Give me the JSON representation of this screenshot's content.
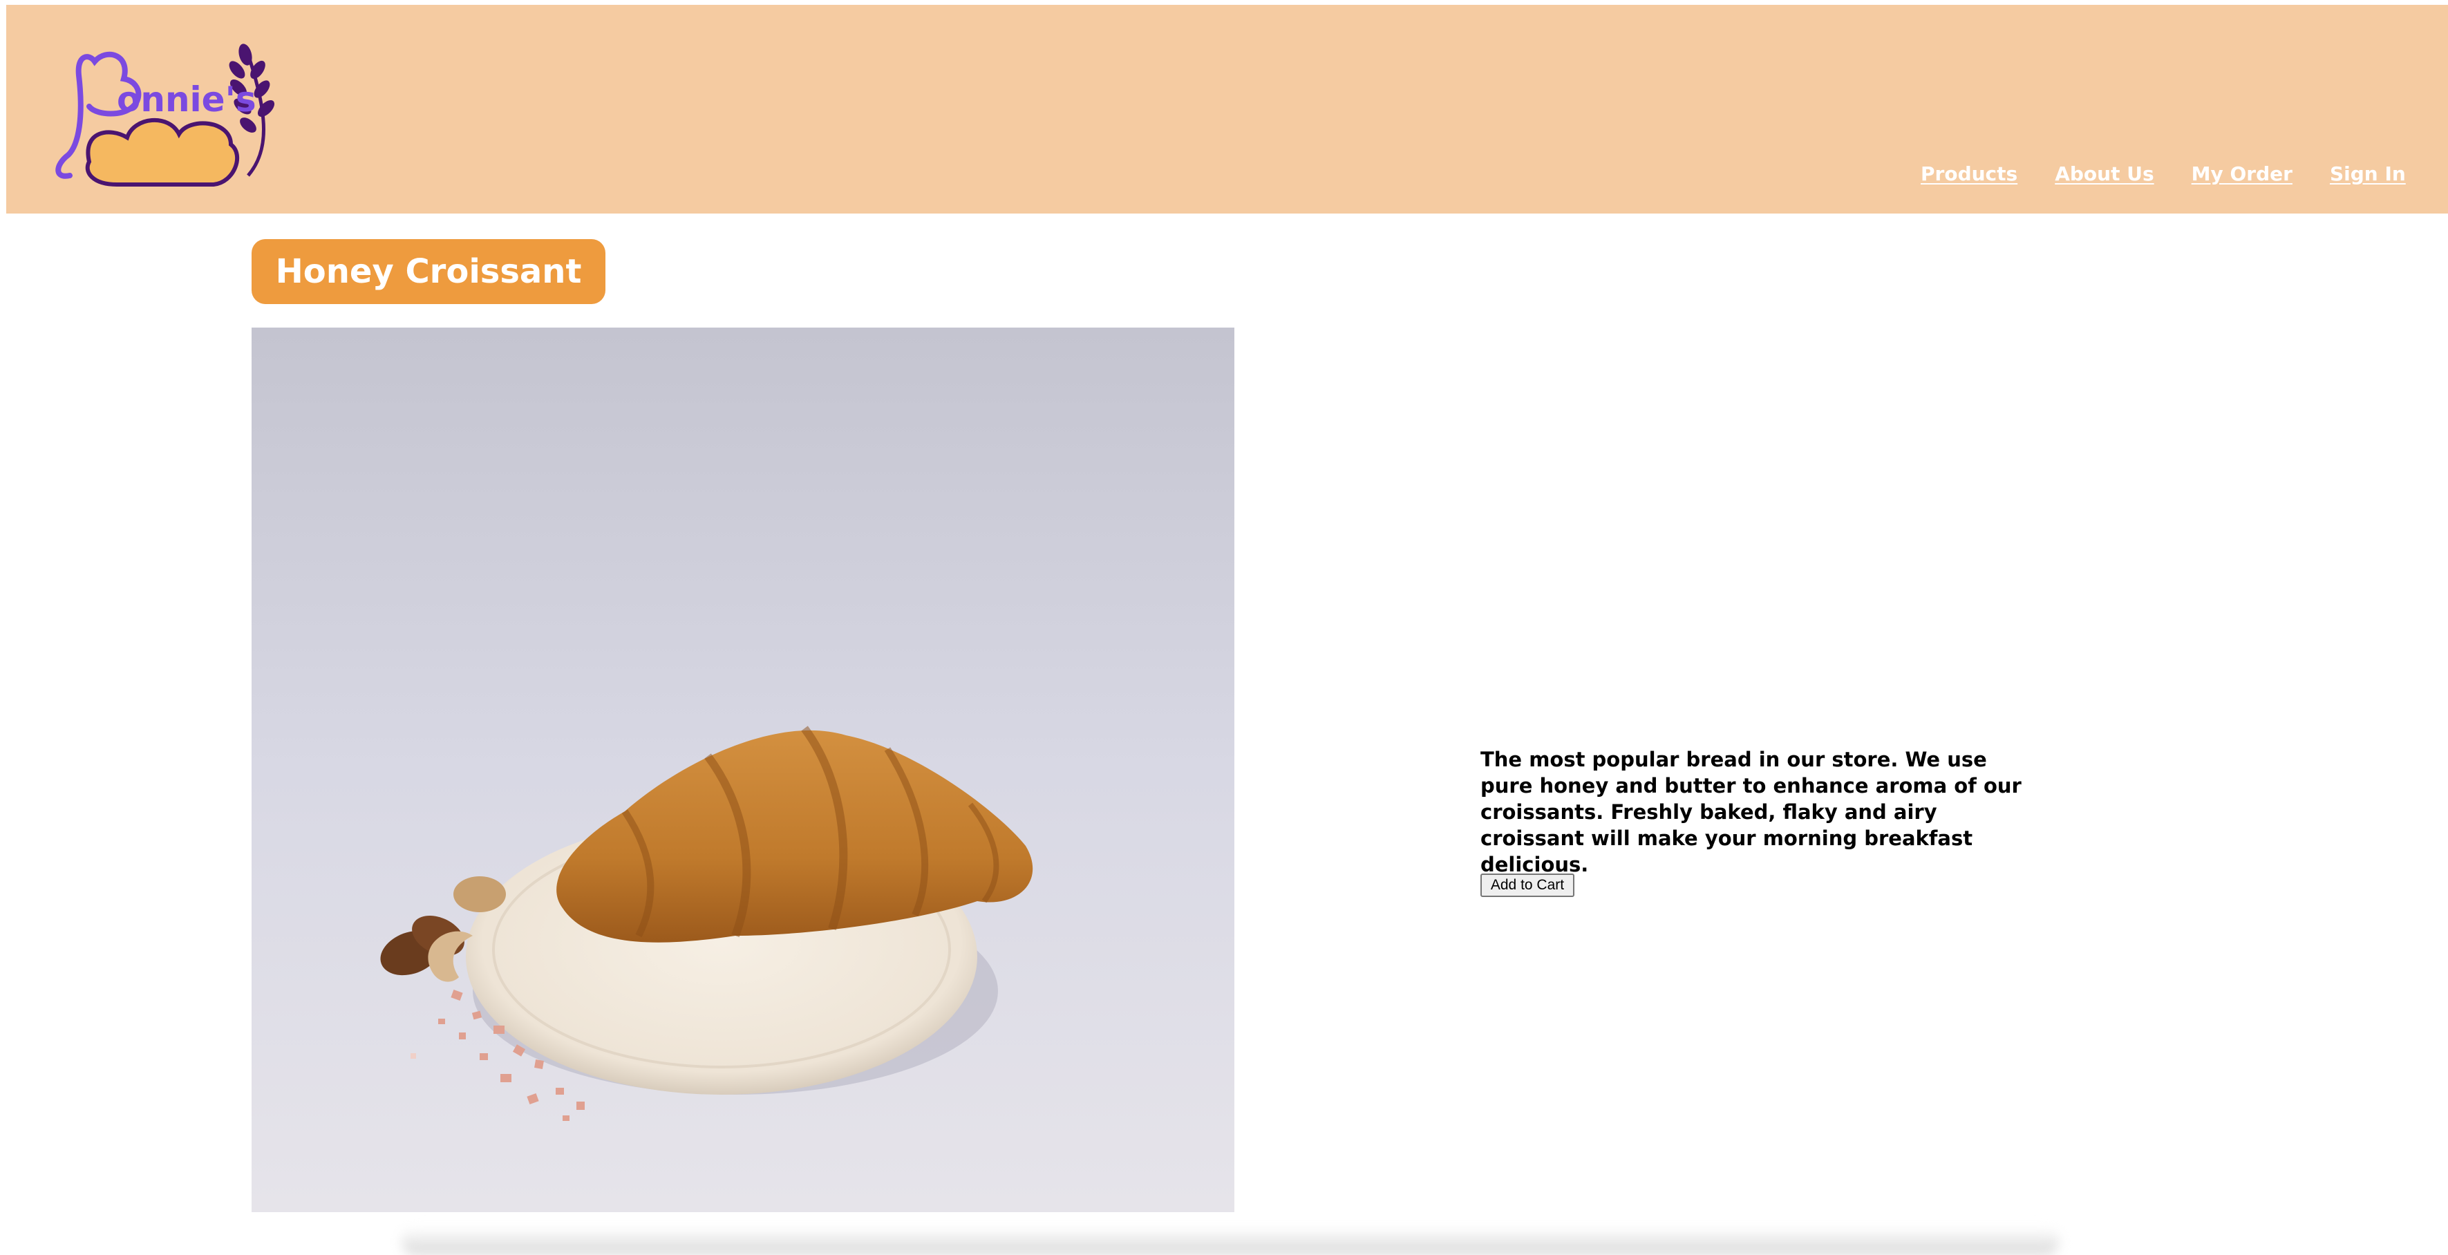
{
  "brand": {
    "logo_text": "Bonnie's",
    "colors": {
      "header_bg": "#f5cba1",
      "accent": "#ee9b3e",
      "logo_purple": "#7b4ae0",
      "logo_dark_purple": "#4a1470",
      "bread": "#f5b860"
    }
  },
  "nav": {
    "items": [
      {
        "label": "Products"
      },
      {
        "label": "About Us"
      },
      {
        "label": "My Order"
      },
      {
        "label": "Sign In"
      }
    ]
  },
  "product": {
    "title": "Honey Croissant",
    "image_icon": "croissant-photo",
    "description": "The most popular bread in our store. We use pure honey and butter to enhance aroma of our croissants. Freshly baked, flaky and airy croissant will make your morning breakfast delicious.",
    "add_to_cart_label": "Add to Cart"
  }
}
